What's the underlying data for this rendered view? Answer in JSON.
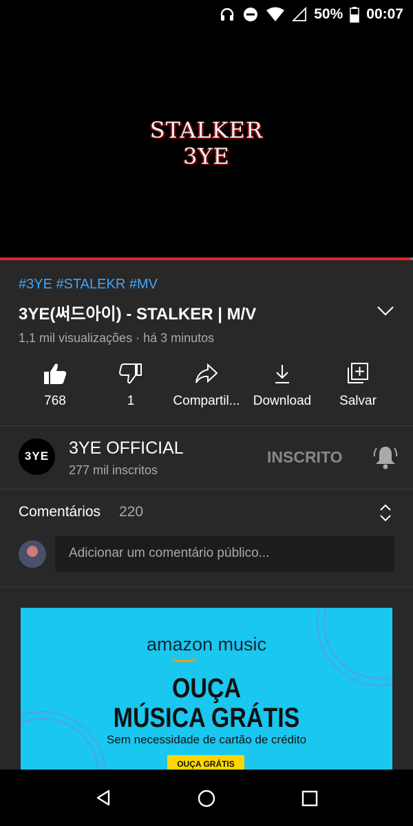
{
  "status_bar": {
    "battery": "50%",
    "time": "00:07",
    "icons": [
      "headphones-icon",
      "do-not-disturb-icon",
      "wifi-icon",
      "cell-signal-icon",
      "battery-icon"
    ]
  },
  "video": {
    "overlay_line1": "STALKER",
    "overlay_line2": "3YE",
    "progress": 0.993
  },
  "info": {
    "hashtags": "#3YE #STALEKR #MV",
    "title": "3YE(써드아이) - STALKER | M/V",
    "meta": "1,1 mil visualizações · há 3 minutos"
  },
  "actions": [
    {
      "icon": "thumbs-up-icon",
      "label": "768"
    },
    {
      "icon": "thumbs-down-icon",
      "label": "1"
    },
    {
      "icon": "share-icon",
      "label": "Compartil..."
    },
    {
      "icon": "download-icon",
      "label": "Download"
    },
    {
      "icon": "save-icon",
      "label": "Salvar"
    }
  ],
  "channel": {
    "avatar_text": "3YE",
    "name": "3YE OFFICIAL",
    "subscribers": "277 mil inscritos",
    "subscribed_label": "INSCRITO"
  },
  "comments": {
    "label": "Comentários",
    "count": "220",
    "placeholder": "Adicionar um comentário público..."
  },
  "ad": {
    "brand": "amazon music",
    "headline1": "OUÇA",
    "headline2": "MÚSICA GRÁTIS",
    "subtext": "Sem necessidade de cartão de crédito",
    "cta": "OUÇA GRÁTIS"
  },
  "colors": {
    "background": "#282828",
    "accent_link": "#3ea6ff",
    "progress": "#ee2222",
    "ad_background": "#1ac7ef"
  }
}
